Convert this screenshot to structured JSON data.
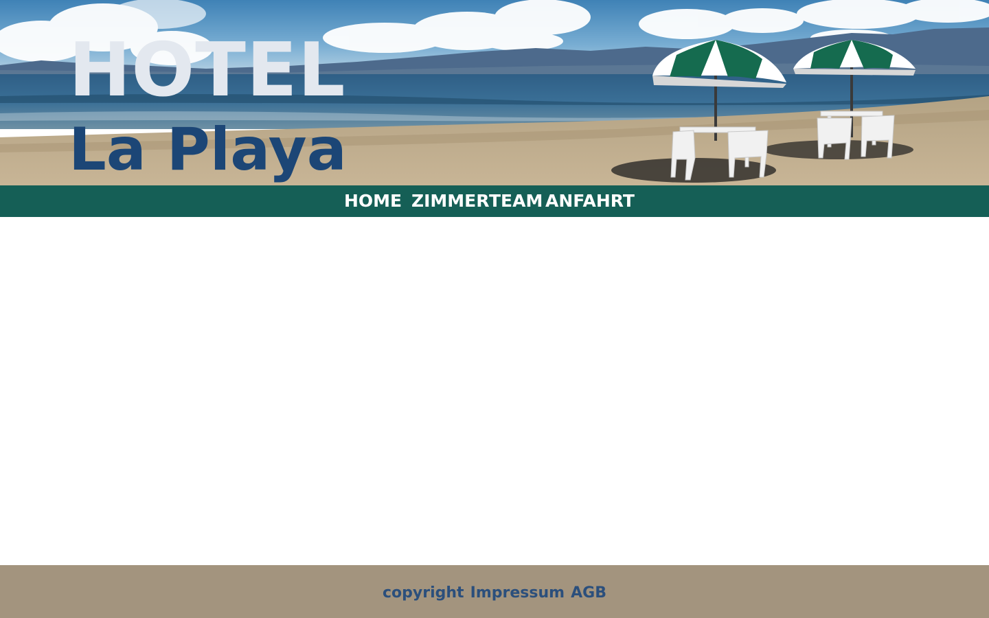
{
  "header": {
    "title_line1": "HOTEL",
    "title_line2": "La Playa",
    "banner_image": "beach-with-umbrellas-and-tables"
  },
  "nav": {
    "items": [
      {
        "label": "HOME"
      },
      {
        "label": "ZIMMER"
      },
      {
        "label": "TEAM"
      },
      {
        "label": "ANFAHRT"
      }
    ]
  },
  "footer": {
    "links": [
      {
        "label": "copyright"
      },
      {
        "label": "Impressum"
      },
      {
        "label": "AGB"
      }
    ]
  },
  "colors": {
    "nav_background": "#155f56",
    "footer_background": "#a3947e",
    "title_line1": "#e3e8ef",
    "title_line2": "#1c4676",
    "footer_text": "#2b4f7c"
  }
}
